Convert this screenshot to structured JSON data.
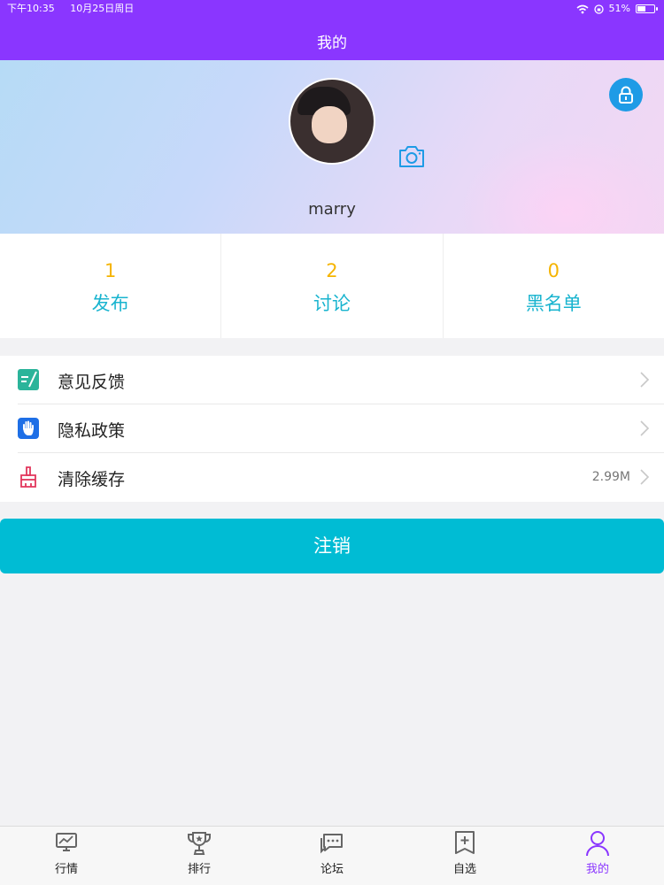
{
  "status_bar": {
    "time": "下午10:35",
    "date": "10月25日周日",
    "battery": "51%"
  },
  "nav": {
    "title": "我的"
  },
  "profile": {
    "username": "marry"
  },
  "stats": [
    {
      "count": "1",
      "label": "发布"
    },
    {
      "count": "2",
      "label": "讨论"
    },
    {
      "count": "0",
      "label": "黑名单"
    }
  ],
  "menu": {
    "feedback_label": "意见反馈",
    "privacy_label": "隐私政策",
    "cache_label": "清除缓存",
    "cache_size": "2.99M"
  },
  "logout_label": "注销",
  "tabs": [
    {
      "label": "行情",
      "icon": "monitor-chart-icon"
    },
    {
      "label": "排行",
      "icon": "trophy-icon"
    },
    {
      "label": "论坛",
      "icon": "chat-bubbles-icon"
    },
    {
      "label": "自选",
      "icon": "add-bookmark-icon"
    },
    {
      "label": "我的",
      "icon": "person-icon"
    }
  ],
  "colors": {
    "brand_purple": "#8a36ff",
    "accent_cyan": "#00bcd4",
    "stat_number": "#f5b400",
    "stat_label": "#19b4cf"
  }
}
